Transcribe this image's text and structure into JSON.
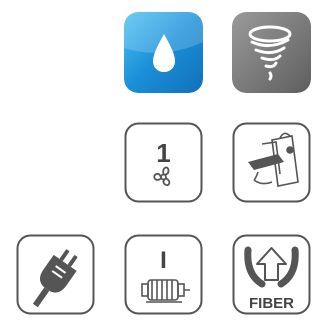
{
  "tiles": [
    {
      "id": "water",
      "icon": "water-drop-icon",
      "bg": "#1a8fd8"
    },
    {
      "id": "vortex",
      "icon": "tornado-icon",
      "bg": "#707070"
    },
    {
      "id": "fan",
      "icon": "fan-speed-icon",
      "number": "1"
    },
    {
      "id": "bag",
      "icon": "bag-filter-icon"
    },
    {
      "id": "plug",
      "icon": "power-plug-icon"
    },
    {
      "id": "motor",
      "icon": "motor-icon",
      "symbol": "I"
    },
    {
      "id": "fiber",
      "icon": "fiber-icon",
      "label": "FIBER"
    }
  ],
  "colors": {
    "water_blue": "#1a8fd8",
    "vortex_gray": "#707070",
    "outline": "#555555",
    "icon_fill": "#555555"
  }
}
